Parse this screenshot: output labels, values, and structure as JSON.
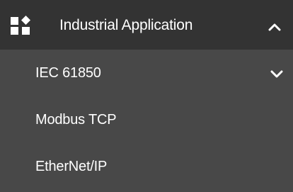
{
  "menu": {
    "header": {
      "label": "Industrial Application",
      "icon": "category-icon",
      "expand_state_icon": "chevron-up-icon"
    },
    "items": [
      {
        "label": "IEC 61850",
        "icon": "chevron-down-icon"
      },
      {
        "label": "Modbus TCP"
      },
      {
        "label": "EtherNet/IP"
      }
    ]
  },
  "colors": {
    "header_bg": "#333333",
    "item_bg": "#484848",
    "text": "#ffffff"
  }
}
